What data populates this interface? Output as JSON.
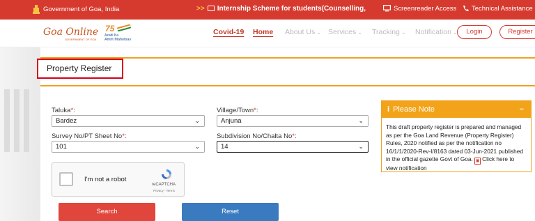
{
  "topbar": {
    "gov_label": "Government of Goa, India",
    "marquee_arrows": ">>",
    "marquee_text": "Internship Scheme for students(Counselling, Psyc",
    "screenreader": "Screenreader Access",
    "technical": "Technical Assistance"
  },
  "header": {
    "logo": "Goa Online",
    "logo_sub": "GOVERNMENT OF GOA",
    "azadi_line1": "Azadi Ka",
    "azadi_line2": "Amrit Mahotsav",
    "azadi_num": "75",
    "nav": {
      "covid": "Covid-19",
      "home": "Home",
      "about": "About Us",
      "services": "Services",
      "tracking": "Tracking",
      "notification": "Notification",
      "chevron": "⌄"
    },
    "login": "Login",
    "register": "Register"
  },
  "page": {
    "title": "Property Register"
  },
  "form": {
    "taluka_label": "Taluka",
    "taluka_value": "Bardez",
    "village_label": "Village/Town",
    "village_value": "Anjuna",
    "survey_label": "Survey No/PT Sheet No",
    "survey_value": "101",
    "subdivision_label": "Subdivision No/Chalta No",
    "subdivision_value": "14",
    "required_mark": "*",
    "colon": ":"
  },
  "captcha": {
    "label": "I'm not a robot",
    "brand": "reCAPTCHA",
    "privacy": "Privacy - Terms"
  },
  "buttons": {
    "search": "Search",
    "reset": "Reset"
  },
  "note": {
    "icon": "i",
    "title": "Please Note",
    "collapse": "−",
    "body": "This draft property register is prepared and managed as per the Goa Land Revenue (Property Register) Rules, 2020 notified as per the notification no 16/1/1/2020-Rev-I/8163 dated 03-Jun-2021 published in the official gazette Govt of Goa.",
    "link": "Click here to view notification"
  },
  "colors": {
    "topbar": "#d63a2f",
    "accent_orange": "#f0a020",
    "search_btn": "#e0463b",
    "reset_btn": "#3a7bbf"
  }
}
